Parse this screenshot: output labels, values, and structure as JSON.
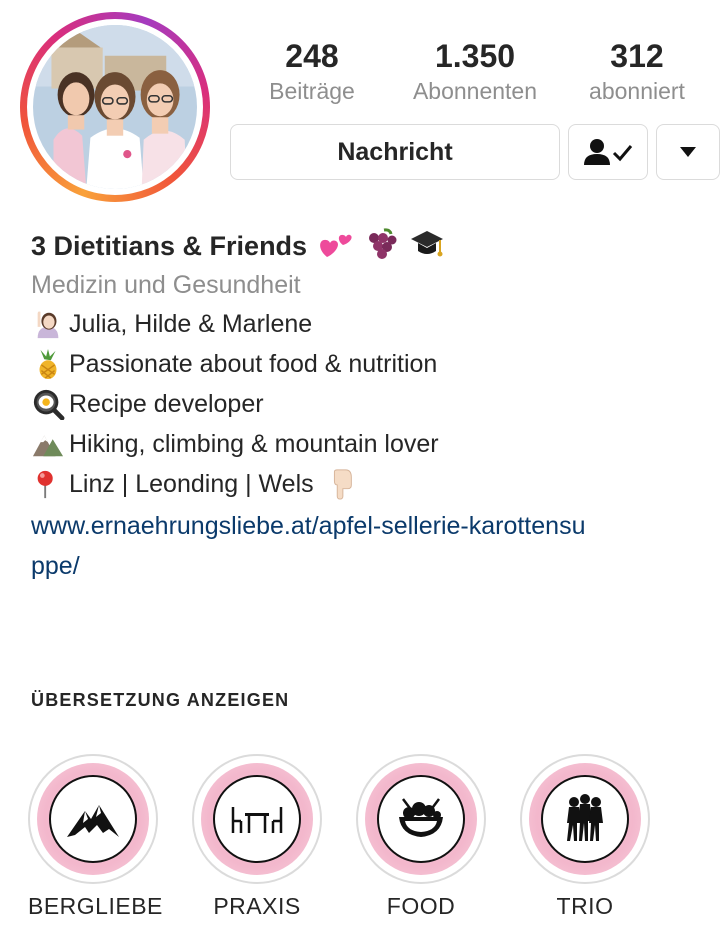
{
  "profile": {
    "stats": {
      "posts": {
        "value": "248",
        "label": "Beiträge"
      },
      "followers": {
        "value": "1.350",
        "label": "Abonnenten"
      },
      "following": {
        "value": "312",
        "label": "abonniert"
      }
    },
    "actions": {
      "message_label": "Nachricht",
      "follow_icon": "person-check-icon",
      "more_icon": "triangle-down-icon"
    },
    "bio": {
      "name": "3 Dietitians & Friends",
      "category": "Medizin und Gesundheit",
      "lines": [
        {
          "icon": "woman-raising-hand-emoji",
          "text": " Julia, Hilde & Marlene"
        },
        {
          "icon": "pineapple-emoji",
          "text": "Passionate about food & nutrition"
        },
        {
          "icon": "frying-pan-emoji",
          "text": "Recipe developer"
        },
        {
          "icon": "mountain-emoji",
          "text": "Hiking, climbing & mountain lover"
        },
        {
          "icon": "round-pushpin-emoji",
          "text": " Linz | Leonding | Wels"
        }
      ],
      "link": "www.ernaehrungsliebe.at/apfel-sellerie-karottensuppe/"
    },
    "translate_label": "ÜBERSETZUNG ANZEIGEN",
    "highlights": [
      {
        "label": "BERGLIEBE",
        "icon": "mountain-icon"
      },
      {
        "label": "PRAXIS",
        "icon": "table-chairs-icon"
      },
      {
        "label": "FOOD",
        "icon": "salad-bowl-icon"
      },
      {
        "label": "TRIO",
        "icon": "three-women-silhouette-icon"
      }
    ]
  },
  "colors": {
    "text": "#262626",
    "secondary": "#8e8e8e",
    "link": "#0b3a6b",
    "border": "#dbdbdb",
    "highlight_pink": "#f3b7cc"
  }
}
